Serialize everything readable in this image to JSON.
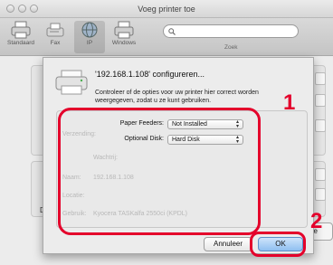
{
  "window": {
    "title": "Voeg printer toe"
  },
  "toolbar": {
    "items": [
      {
        "label": "Standaard",
        "icon": "printer-icon"
      },
      {
        "label": "Fax",
        "icon": "fax-icon"
      },
      {
        "label": "IP",
        "icon": "globe-icon",
        "selected": true
      },
      {
        "label": "Windows",
        "icon": "windows-printer-icon"
      }
    ],
    "search_label": "Zoek",
    "search_placeholder": ""
  },
  "background": {
    "ghost_lines": [
      "Verzending:",
      "Wachtrij:",
      "Naam:",
      "Locatie:",
      "Gebruik:"
    ],
    "ghost_values": [
      "192.168.1.108",
      "Kyocera TASKalfa 2550ci (KPDL)"
    ],
    "d_label": "D"
  },
  "sheet": {
    "title": "'192.168.1.108' configureren...",
    "description": "Controleer of de opties voor uw printer hier correct worden weergegeven, zodat u ze kunt gebruiken.",
    "options": [
      {
        "label": "Paper Feeders:",
        "value": "Not Installed"
      },
      {
        "label": "Optional Disk:",
        "value": "Hard Disk"
      }
    ],
    "cancel_label": "Annuleer",
    "ok_label": "OK"
  },
  "partial_button_label": "be",
  "annotations": {
    "marker_1": "1",
    "marker_2": "2",
    "color": "#e4002b"
  }
}
